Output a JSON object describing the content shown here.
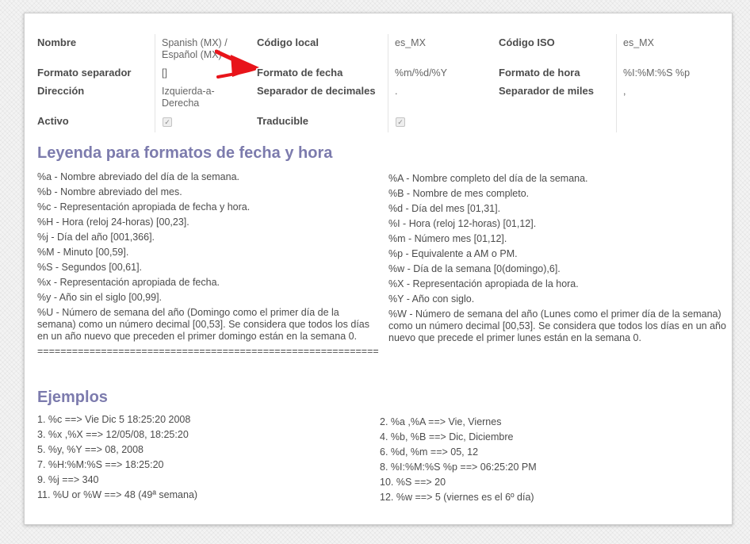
{
  "fields": {
    "nombre": {
      "label": "Nombre",
      "value": "Spanish (MX) / Español (MX)"
    },
    "codigo_local": {
      "label": "Código local",
      "value": "es_MX"
    },
    "codigo_iso": {
      "label": "Código ISO",
      "value": "es_MX"
    },
    "formato_separador": {
      "label": "Formato separador",
      "value": "[]"
    },
    "formato_fecha": {
      "label": "Formato de fecha",
      "value": "%m/%d/%Y"
    },
    "formato_hora": {
      "label": "Formato de hora",
      "value": "%I:%M:%S %p"
    },
    "direccion": {
      "label": "Dirección",
      "value": "Izquierda-a-Derecha"
    },
    "separador_decimales": {
      "label": "Separador de decimales",
      "value": "."
    },
    "separador_miles": {
      "label": "Separador de miles",
      "value": ","
    },
    "activo": {
      "label": "Activo",
      "checked": true
    },
    "traducible": {
      "label": "Traducible",
      "checked": true
    }
  },
  "legend": {
    "title": "Leyenda para formatos de fecha y hora",
    "left": [
      "%a - Nombre abreviado del día de la semana.",
      "%b - Nombre abreviado del mes.",
      "%c - Representación apropiada de fecha y hora.",
      "%H - Hora (reloj 24-horas) [00,23].",
      "%j - Día del año [001,366].",
      "%M - Minuto [00,59].",
      "%S - Segundos [00,61].",
      "%x - Representación apropiada de fecha.",
      "%y - Año sin el siglo [00,99].",
      "%U - Número de semana del año (Domingo como el primer día de la semana) como un número decimal [00,53]. Se considera que todos los días en un año nuevo que preceden el primer domingo están en la semana 0."
    ],
    "separator": "===========================================================",
    "right": [
      "%A - Nombre completo del día de la semana.",
      "%B - Nombre de mes completo.",
      "%d - Día del mes [01,31].",
      "%I - Hora (reloj 12-horas) [01,12].",
      "%m - Número mes [01,12].",
      "%p - Equivalente a AM o PM.",
      "%w - Día de la semana [0(domingo),6].",
      "%X - Representación apropiada de la hora.",
      "%Y - Año con siglo.",
      "%W - Número de semana del año (Lunes como el primer día de la semana) como un número decimal [00,53]. Se considera que todos los días en un año nuevo que precede el primer lunes están en la semana 0."
    ]
  },
  "examples": {
    "title": "Ejemplos",
    "left": [
      "1. %c ==> Vie Dic 5 18:25:20 2008",
      "3. %x ,%X ==> 12/05/08, 18:25:20",
      "5. %y, %Y ==> 08, 2008",
      "7. %H:%M:%S ==> 18:25:20",
      "9. %j ==> 340",
      "11. %U or %W ==> 48 (49ª semana)"
    ],
    "right": [
      "2. %a ,%A ==> Vie, Viernes",
      "4. %b, %B ==> Dic, Diciembre",
      "6. %d, %m ==> 05, 12",
      "8. %I:%M:%S %p ==> 06:25:20 PM",
      "10. %S ==> 20",
      "12. %w ==> 5 (viernes es el 6º día)"
    ]
  },
  "colors": {
    "heading": "#7c7bad",
    "arrow": "#e8141a"
  }
}
